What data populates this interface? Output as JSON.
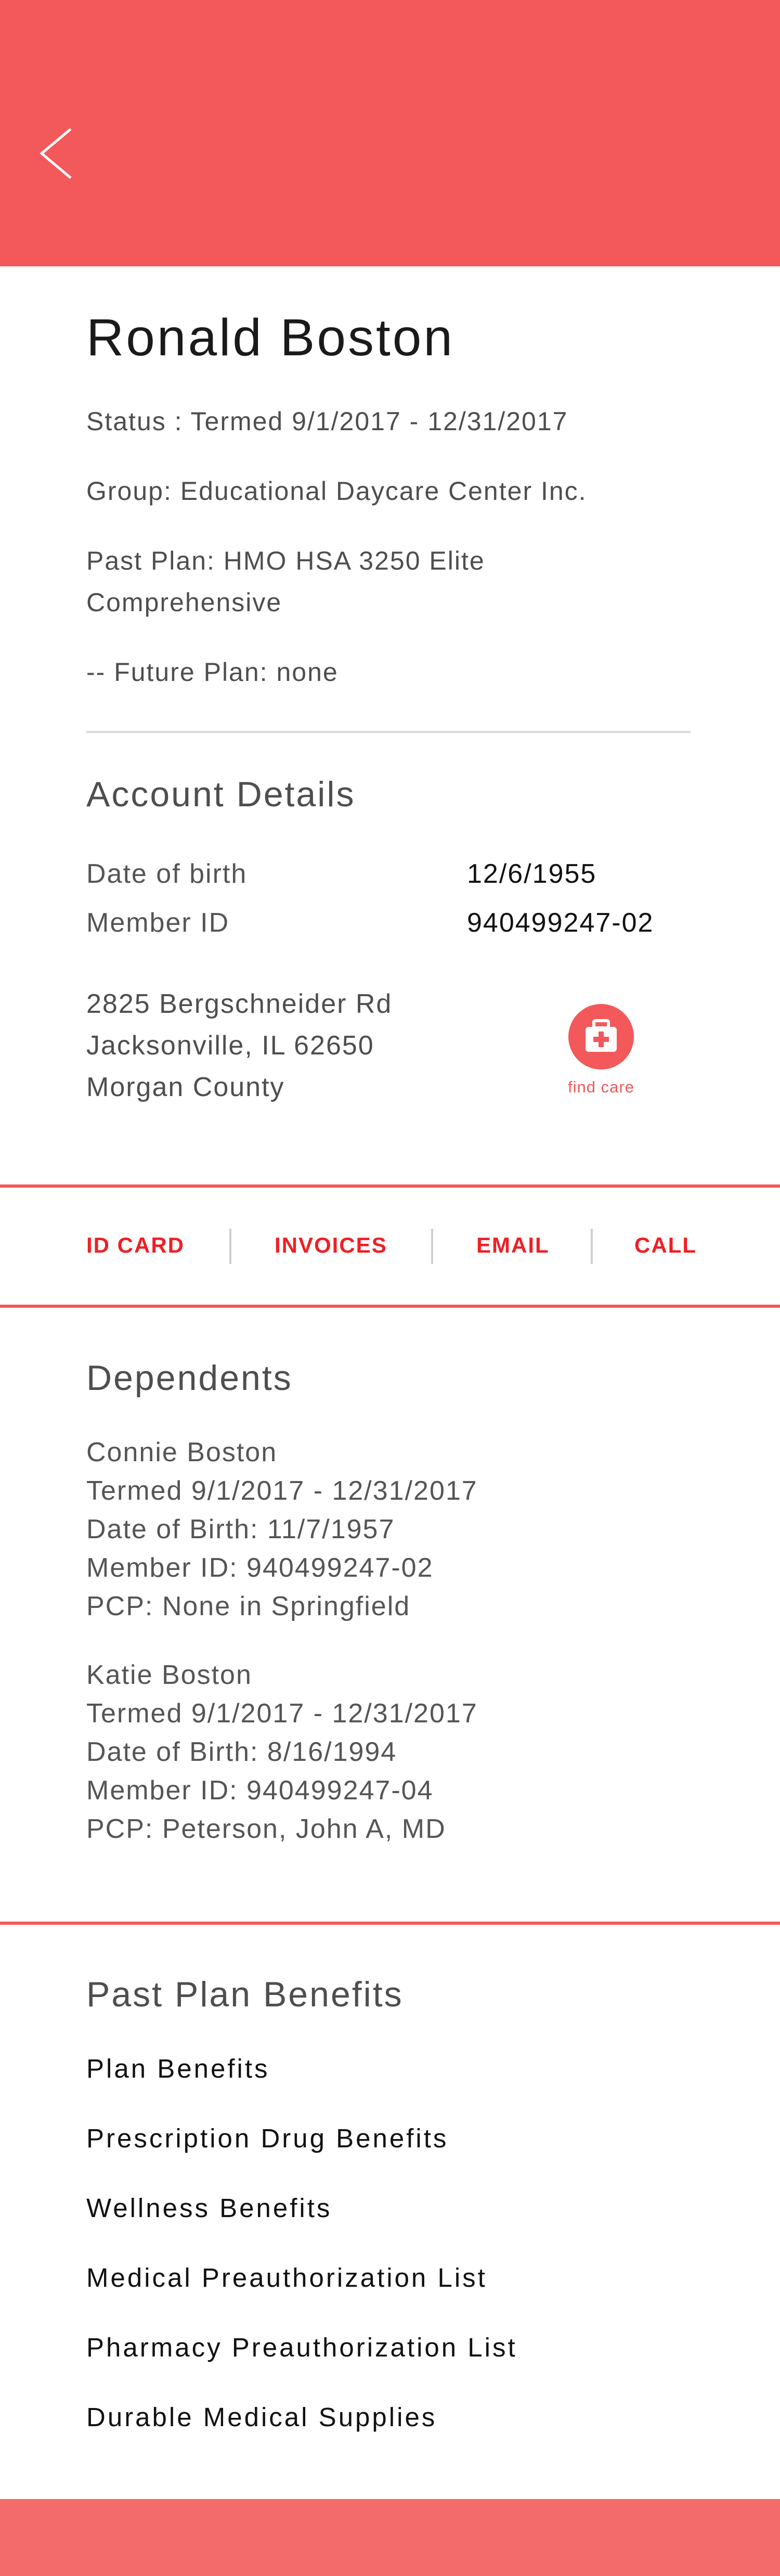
{
  "colors": {
    "accent": "#f3585a",
    "action_text": "#f01f24",
    "footer": "#f46b6c"
  },
  "header": {
    "back_icon": "chevron-left-icon"
  },
  "member": {
    "name": "Ronald Boston",
    "status": "Status : Termed 9/1/2017 - 12/31/2017",
    "group": "Group: Educational Daycare Center Inc.",
    "past_plan_line1": "Past Plan: HMO HSA 3250 Elite",
    "past_plan_line2": "Comprehensive",
    "future_plan": "-- Future Plan: none"
  },
  "account": {
    "title": "Account Details",
    "dob_label": "Date of birth",
    "dob_value": "12/6/1955",
    "member_id_label": "Member ID",
    "member_id_value": "940499247-02",
    "address_line1": "2825 Bergschneider Rd",
    "address_line2": "Jacksonville, IL 62650",
    "address_line3": "Morgan County",
    "find_care_icon": "first-aid-kit-icon",
    "find_care_label": "find care"
  },
  "actions": {
    "id_card": "ID CARD",
    "invoices": "INVOICES",
    "email": "EMAIL",
    "call": "CALL"
  },
  "dependents": {
    "title": "Dependents",
    "items": [
      {
        "name": "Connie Boston",
        "status": "Termed 9/1/2017 - 12/31/2017",
        "dob": "Date of Birth: 11/7/1957",
        "member_id": "Member ID: 940499247-02",
        "pcp": "PCP: None in Springfield"
      },
      {
        "name": "Katie Boston",
        "status": "Termed 9/1/2017 - 12/31/2017",
        "dob": "Date of Birth: 8/16/1994",
        "member_id": "Member ID: 940499247-04",
        "pcp": "PCP: Peterson, John A, MD"
      }
    ]
  },
  "benefits": {
    "title": "Past Plan Benefits",
    "items": [
      "Plan Benefits",
      "Prescription Drug Benefits",
      "Wellness Benefits",
      "Medical Preauthorization List",
      "Pharmacy Preauthorization List",
      "Durable Medical Supplies"
    ]
  }
}
